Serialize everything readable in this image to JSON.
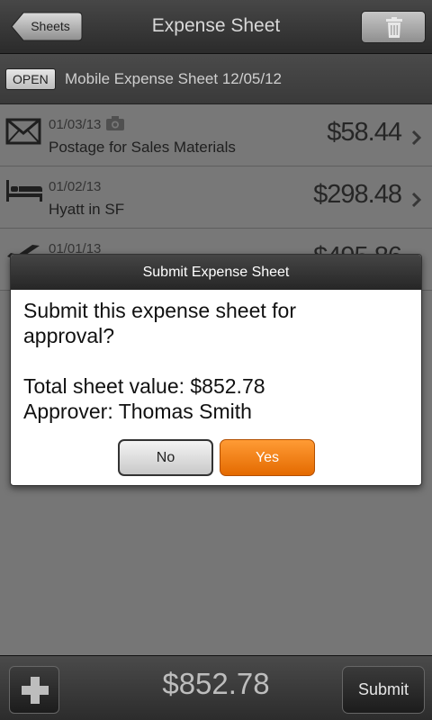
{
  "topbar": {
    "back_label": "Sheets",
    "title": "Expense Sheet",
    "trash_icon": "trash-icon"
  },
  "sheet": {
    "status": "OPEN",
    "name": "Mobile Expense Sheet 12/05/12"
  },
  "expenses": [
    {
      "date": "01/03/13",
      "description": "Postage for Sales Materials",
      "amount": "$58.44",
      "icon": "envelope-icon",
      "has_receipt": true
    },
    {
      "date": "01/02/13",
      "description": "Hyatt in SF",
      "amount": "$298.48",
      "icon": "bed-icon",
      "has_receipt": false
    },
    {
      "date": "01/01/13",
      "description": "",
      "amount": "$495.86",
      "icon": "airplane-icon",
      "has_receipt": false
    }
  ],
  "dialog": {
    "title": "Submit Expense Sheet",
    "line1": "Submit this expense sheet for",
    "line2": "approval?",
    "line3": "Total sheet value: $852.78",
    "line4": "Approver: Thomas Smith",
    "no_label": "No",
    "yes_label": "Yes"
  },
  "bottombar": {
    "total": "$852.78",
    "submit_label": "Submit"
  },
  "colors": {
    "accent": "#f07800",
    "bar": "#2c2c2c",
    "list_bg": "#8c8c8c"
  }
}
